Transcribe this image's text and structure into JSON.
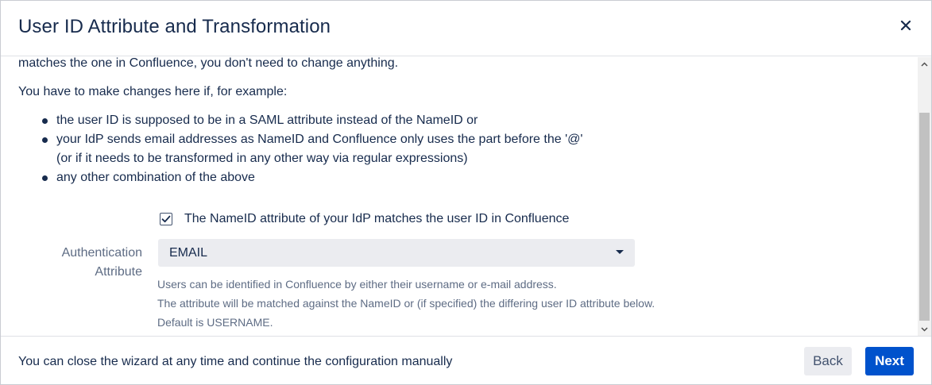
{
  "dialog": {
    "title": "User ID Attribute and Transformation",
    "close_icon": "close-icon"
  },
  "content": {
    "intro_line": "matches the one in Confluence, you don't need to change anything.",
    "paragraph": "You have to make changes here if, for example:",
    "bullets": [
      "the user ID is supposed to be in a SAML attribute instead of the NameID or",
      "your IdP sends email addresses as NameID and Confluence only uses the part before the '@'",
      "any other combination of the above"
    ],
    "bullet_2_continuation": "(or if it needs to be transformed in any other way via regular expressions)"
  },
  "form": {
    "checkbox_label": "The NameID attribute of your IdP matches the user ID in Confluence",
    "checkbox_checked": true,
    "auth_label_line1": "Authentication",
    "auth_label_line2": "Attribute",
    "auth_select_value": "EMAIL",
    "help_lines": [
      "Users can be identified in Confluence by either their username or e-mail address.",
      "The attribute will be matched against the NameID or (if specified) the differing user ID attribute below.",
      "Default is USERNAME."
    ]
  },
  "footer": {
    "text": "You can close the wizard at any time and continue the configuration manually",
    "back_label": "Back",
    "next_label": "Next"
  },
  "colors": {
    "primary_button": "#0052cc",
    "secondary_button": "#ebecf0",
    "text": "#172b4d",
    "subtle_text": "#5e6c84"
  }
}
